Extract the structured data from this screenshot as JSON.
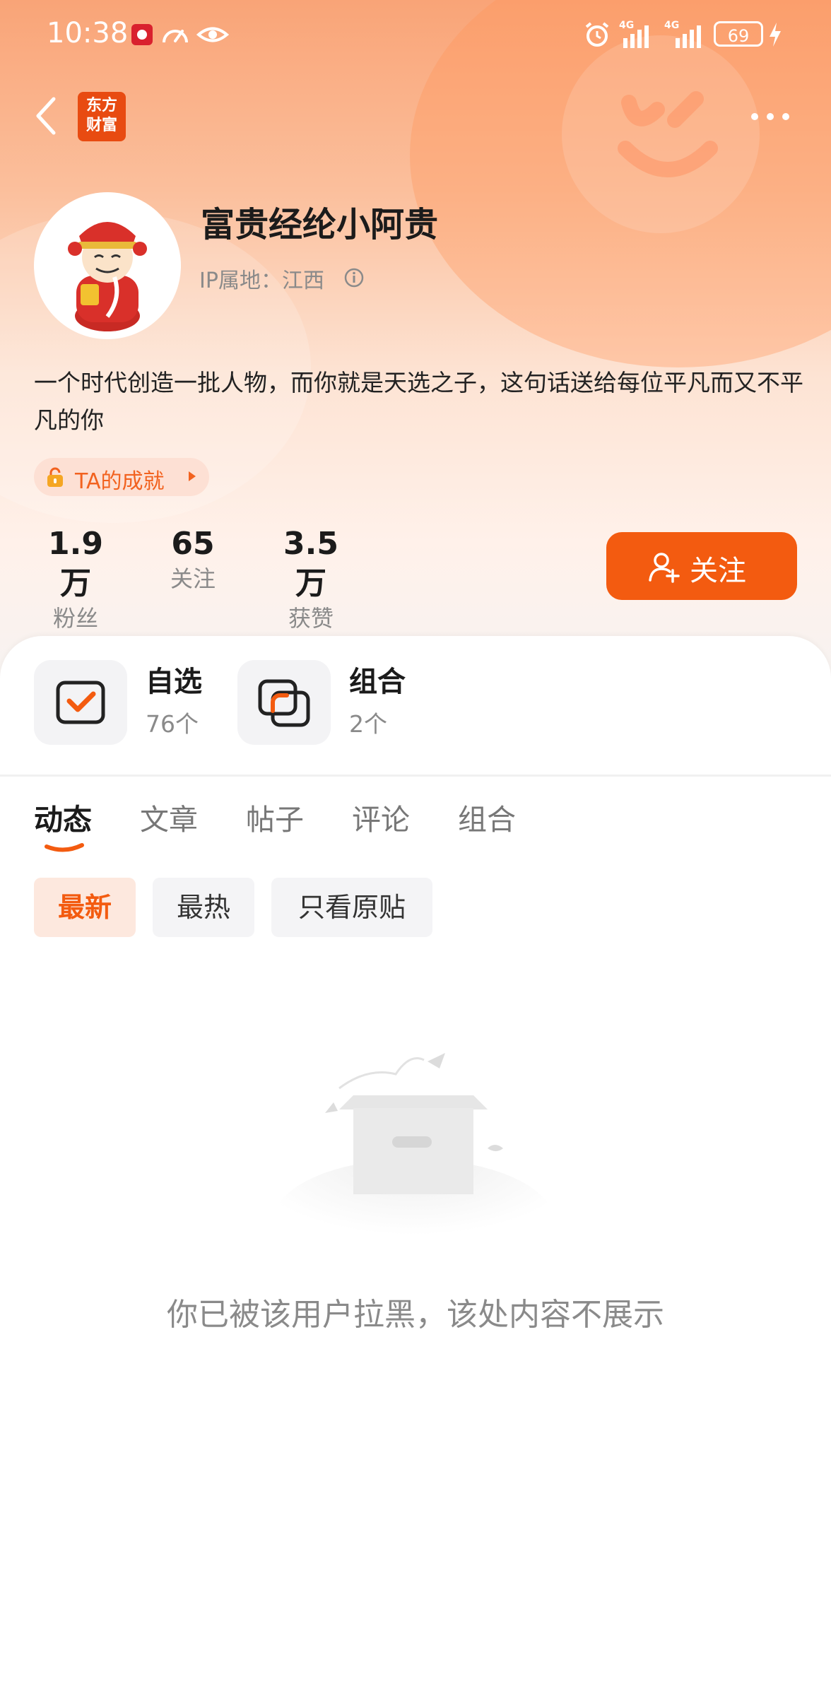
{
  "status_bar": {
    "time": "10:38",
    "battery": "69",
    "network_1": "4G",
    "network_2": "4G"
  },
  "nav": {
    "logo_line1": "东方",
    "logo_line2": "财富"
  },
  "profile": {
    "name": "富贵经纶小阿贵",
    "ip_location": "IP属地：江西",
    "bio": "一个时代创造一批人物，而你就是天选之子，这句话送给每位平凡而又不平凡的你",
    "achievement_label": "TA的成就"
  },
  "stats": [
    {
      "value": "1.9万",
      "label": "粉丝"
    },
    {
      "value": "65",
      "label": "关注"
    },
    {
      "value": "3.5万",
      "label": "获赞"
    }
  ],
  "follow_button": "关注",
  "shortcuts": [
    {
      "title": "自选",
      "subtitle": "76个"
    },
    {
      "title": "组合",
      "subtitle": "2个"
    }
  ],
  "tabs": [
    "动态",
    "文章",
    "帖子",
    "评论",
    "组合"
  ],
  "filters": [
    "最新",
    "最热",
    "只看原贴"
  ],
  "empty_message": "你已被该用户拉黑，该处内容不展示",
  "colors": {
    "accent": "#f35b10",
    "brand": "#e84b11"
  }
}
